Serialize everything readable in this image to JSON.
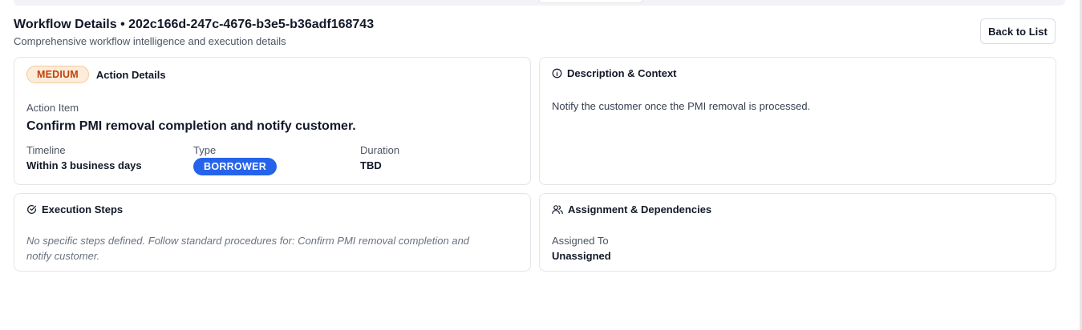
{
  "header": {
    "title": "Workflow Details • 202c166d-247c-4676-b3e5-b36adf168743",
    "subtitle": "Comprehensive workflow intelligence and execution details",
    "back_label": "Back to List"
  },
  "action_card": {
    "priority_badge": "MEDIUM",
    "heading": "Action Details",
    "action_item_label": "Action Item",
    "action_item_value": "Confirm PMI removal completion and notify customer.",
    "timeline_label": "Timeline",
    "timeline_value": "Within 3 business days",
    "type_label": "Type",
    "type_value": "BORROWER",
    "duration_label": "Duration",
    "duration_value": "TBD"
  },
  "description_card": {
    "heading": "Description & Context",
    "text": "Notify the customer once the PMI removal is processed."
  },
  "execution_card": {
    "heading": "Execution Steps",
    "text_line1": "No specific steps defined. Follow standard procedures for: Confirm PMI removal completion and",
    "text_line2": "notify customer."
  },
  "assignment_card": {
    "heading": "Assignment & Dependencies",
    "assigned_label": "Assigned To",
    "assigned_value": "Unassigned"
  },
  "colors": {
    "priority_bg": "#fdecd9",
    "priority_text": "#c2410c",
    "type_badge_bg": "#2563eb",
    "card_border": "#e2e5ea"
  },
  "icons": {
    "description": "info-circle-icon",
    "execution": "check-circle-icon",
    "assignment": "users-icon"
  }
}
